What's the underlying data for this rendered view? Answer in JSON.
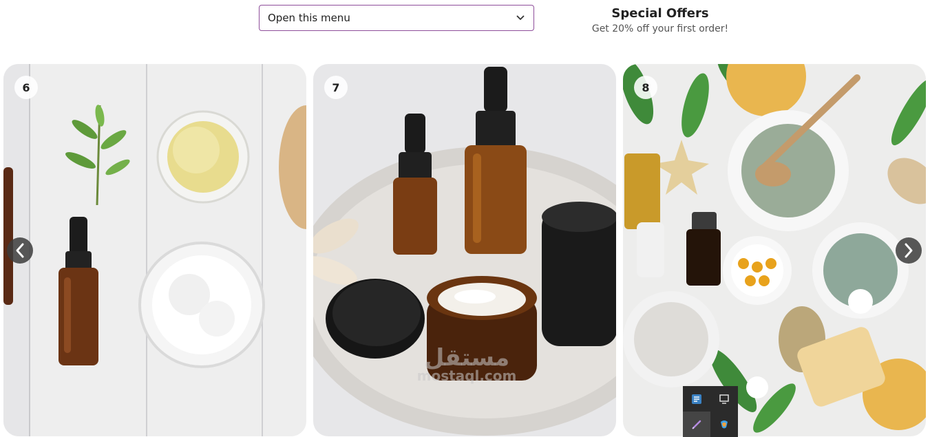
{
  "header": {
    "select": {
      "label": "Open this menu",
      "chevron_icon": "chevron-down-icon"
    },
    "offers": {
      "title": "Special Offers",
      "subtitle": "Get 20% off your first order!"
    }
  },
  "carousel": {
    "cards": [
      {
        "number": "6",
        "subject": "essential oil dropper bottle with oil and salt bowls"
      },
      {
        "number": "7",
        "subject": "amber dropper bottles and cream jars on a tray"
      },
      {
        "number": "8",
        "subject": "clay masks, sponges and herbs flat lay"
      }
    ],
    "prev_icon": "chevron-left-icon",
    "next_icon": "chevron-right-icon",
    "watermark": {
      "arabic": "مستقل",
      "latin": "mostaql.com"
    }
  },
  "tray": {
    "icons": [
      "network-icon",
      "display-icon",
      "pen-icon",
      "copilot-icon"
    ]
  },
  "colors": {
    "select_border": "#8e4d9a",
    "arrow_bg": "#3c3c3c",
    "tray_bg": "#2b2b2b"
  }
}
